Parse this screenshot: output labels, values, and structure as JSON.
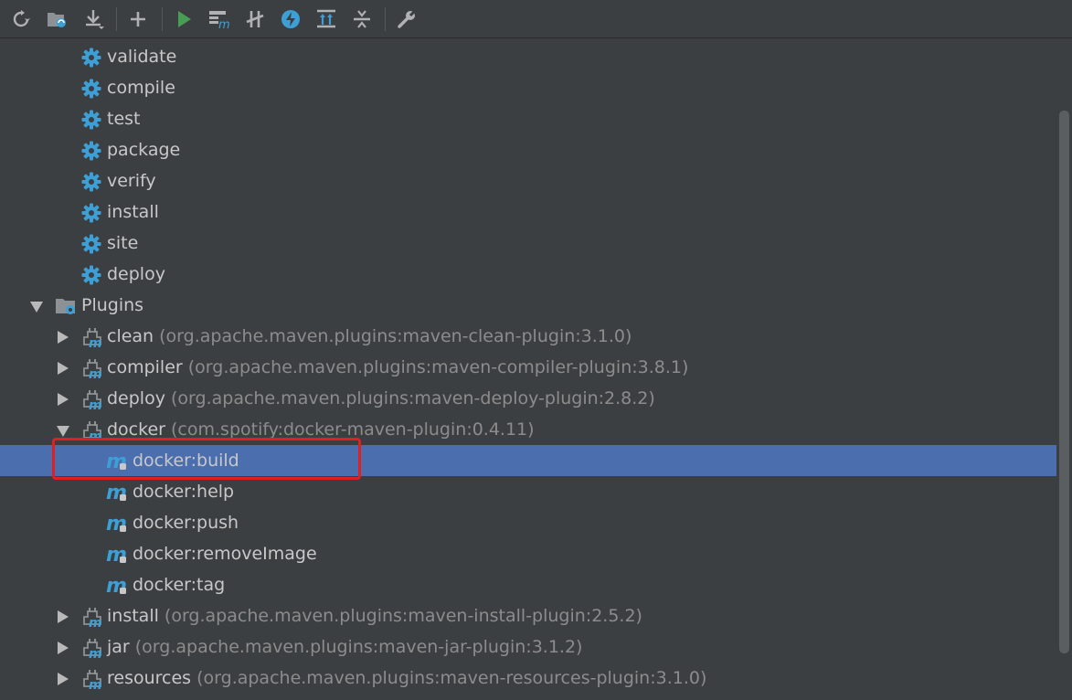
{
  "toolbar": {
    "buttons": [
      {
        "name": "reimport-icon"
      },
      {
        "name": "add-maven-projects-icon"
      },
      {
        "name": "download-sources-icon"
      },
      {
        "name": "add-icon"
      },
      {
        "name": "run-icon"
      },
      {
        "name": "execute-maven-goal-icon"
      },
      {
        "name": "toggle-offline-icon"
      },
      {
        "name": "skip-tests-icon"
      },
      {
        "name": "show-dependencies-icon"
      },
      {
        "name": "collapse-all-icon"
      },
      {
        "name": "settings-wrench-icon"
      }
    ]
  },
  "lifecycle": [
    "validate",
    "compile",
    "test",
    "package",
    "verify",
    "install",
    "site",
    "deploy"
  ],
  "plugins_label": "Plugins",
  "plugins": [
    {
      "name": "clean",
      "coord": "(org.apache.maven.plugins:maven-clean-plugin:3.1.0)"
    },
    {
      "name": "compiler",
      "coord": "(org.apache.maven.plugins:maven-compiler-plugin:3.8.1)"
    },
    {
      "name": "deploy",
      "coord": "(org.apache.maven.plugins:maven-deploy-plugin:2.8.2)"
    },
    {
      "name": "docker",
      "coord": "(com.spotify:docker-maven-plugin:0.4.11)"
    }
  ],
  "docker_goals": [
    "docker:build",
    "docker:help",
    "docker:push",
    "docker:removeImage",
    "docker:tag"
  ],
  "plugins_after": [
    {
      "name": "install",
      "coord": "(org.apache.maven.plugins:maven-install-plugin:2.5.2)"
    },
    {
      "name": "jar",
      "coord": "(org.apache.maven.plugins:maven-jar-plugin:3.1.2)"
    },
    {
      "name": "resources",
      "coord": "(org.apache.maven.plugins:maven-resources-plugin:3.1.0)"
    }
  ],
  "colors": {
    "background": "#3c3f41",
    "selection": "#4b6eaf",
    "gear": "#3d9fd6",
    "maven": "#3d9fd6",
    "highlight": "#e02020"
  }
}
